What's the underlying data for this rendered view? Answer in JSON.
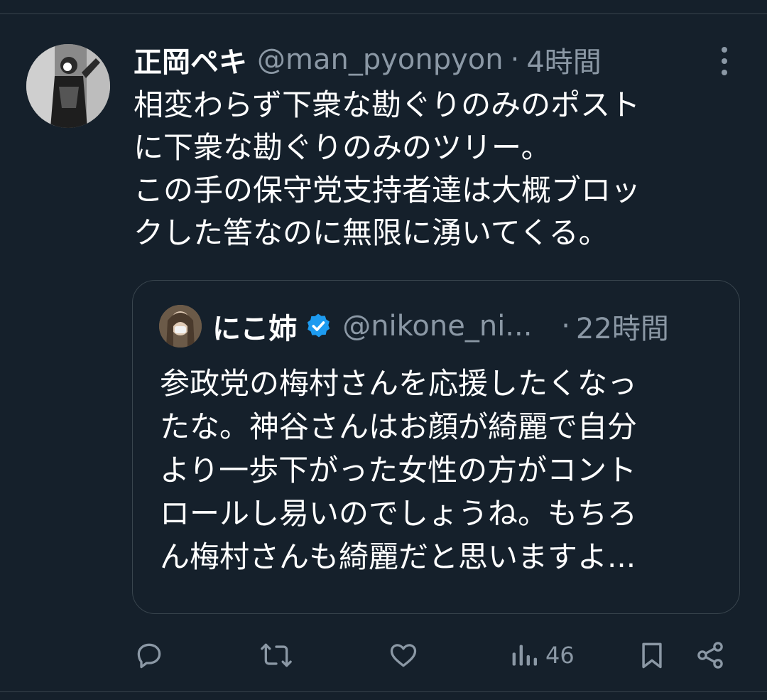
{
  "tweet": {
    "author_name": "正岡ペキ",
    "author_handle": "@man_pyonpyon",
    "separator": "·",
    "time": "4時間",
    "text_lines": [
      "相変わらず下衆な勘ぐりのみのポスト",
      "に下衆な勘ぐりのみのツリー。",
      "この手の保守党支持者達は大概ブロッ",
      "クした筈なのに無限に湧いてくる。"
    ]
  },
  "quote": {
    "author_name": "にこ姉",
    "author_handle": "@nikone_ni...",
    "separator": "·",
    "time": "22時間",
    "text_lines": [
      "参政党の梅村さんを応援したくなっ",
      "たな。神谷さんはお顔が綺麗で自分",
      "より一歩下がった女性の方がコント",
      "ロールし易いのでしょうね。もちろ",
      "ん梅村さんも綺麗だと思いますよ..."
    ]
  },
  "actions": {
    "views_count": "46"
  },
  "icons": {
    "more": "more-vertical-icon",
    "verified": "verified-badge-icon",
    "reply": "reply-icon",
    "retweet": "retweet-icon",
    "like": "heart-icon",
    "views": "views-chart-icon",
    "bookmark": "bookmark-icon",
    "share": "share-icon"
  },
  "colors": {
    "background": "#15202b",
    "text_primary": "#ffffff",
    "text_secondary": "#8b98a5",
    "border": "#38444d",
    "verified": "#1d9bf0"
  }
}
